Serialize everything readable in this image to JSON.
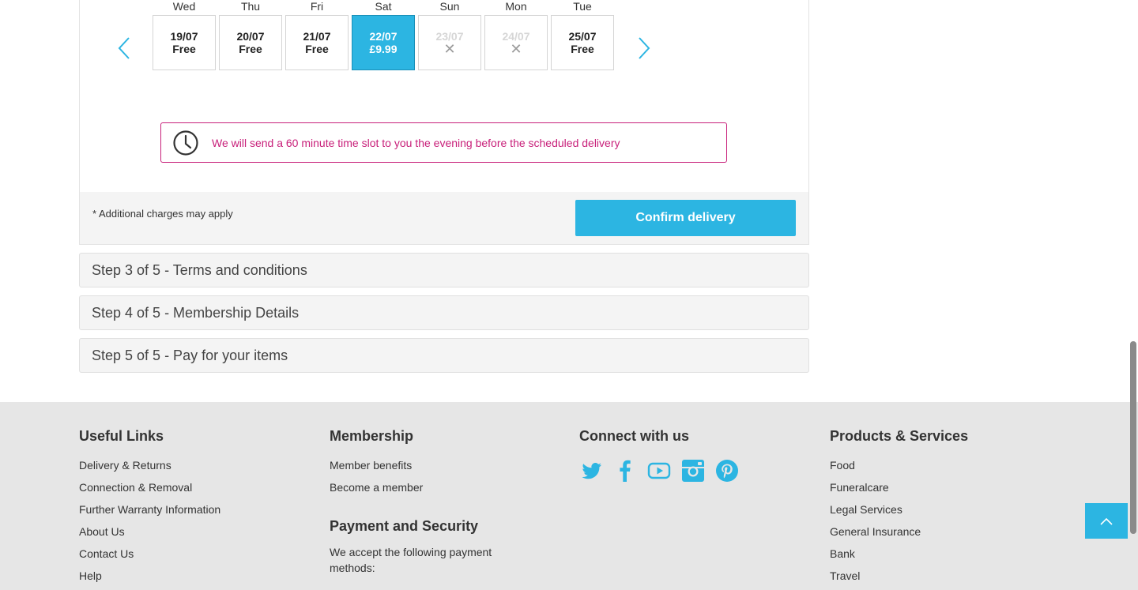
{
  "calendar": {
    "days": [
      {
        "name": "Wed",
        "date": "19/07",
        "price": "Free",
        "state": "available"
      },
      {
        "name": "Thu",
        "date": "20/07",
        "price": "Free",
        "state": "available"
      },
      {
        "name": "Fri",
        "date": "21/07",
        "price": "Free",
        "state": "available"
      },
      {
        "name": "Sat",
        "date": "22/07",
        "price": "£9.99",
        "state": "selected"
      },
      {
        "name": "Sun",
        "date": "23/07",
        "price": "✕",
        "state": "disabled"
      },
      {
        "name": "Mon",
        "date": "24/07",
        "price": "✕",
        "state": "disabled"
      },
      {
        "name": "Tue",
        "date": "25/07",
        "price": "Free",
        "state": "available"
      }
    ],
    "prev_icon": "chevron-left-icon",
    "next_icon": "chevron-right-icon"
  },
  "notice": {
    "icon": "clock-icon",
    "message": "We will send a 60 minute time slot to you the evening before the scheduled delivery"
  },
  "card_footer": {
    "note": "* Additional charges may apply",
    "confirm_label": "Confirm delivery"
  },
  "steps": [
    {
      "label": "Step 3 of 5 - Terms and conditions"
    },
    {
      "label": "Step 4 of 5 - Membership Details"
    },
    {
      "label": "Step 5 of 5 - Pay for your items"
    }
  ],
  "footer": {
    "useful_links": {
      "title": "Useful Links",
      "links": [
        "Delivery & Returns",
        "Connection & Removal",
        "Further Warranty Information",
        "About Us",
        "Contact Us",
        "Help"
      ]
    },
    "membership": {
      "title": "Membership",
      "links": [
        "Member benefits",
        "Become a member"
      ]
    },
    "payment": {
      "title": "Payment and Security",
      "text": "We accept the following payment methods:"
    },
    "connect": {
      "title": "Connect with us",
      "icons": [
        "twitter-icon",
        "facebook-icon",
        "youtube-icon",
        "instagram-icon",
        "pinterest-icon"
      ]
    },
    "products": {
      "title": "Products & Services",
      "links": [
        "Food",
        "Funeralcare",
        "Legal Services",
        "General Insurance",
        "Bank",
        "Travel"
      ]
    }
  },
  "colors": {
    "accent": "#2cb5e2",
    "notice": "#c8207a",
    "footer_bg": "#e6e6e6"
  }
}
